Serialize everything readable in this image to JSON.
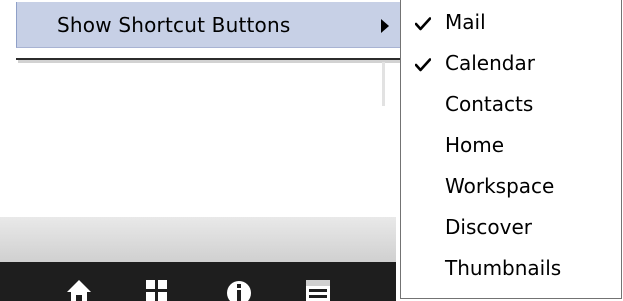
{
  "parent_menu": {
    "item_label": "Show Shortcut Buttons",
    "submenu_arrow_icon": "triangle-right-icon"
  },
  "submenu": {
    "items": [
      {
        "label": "Mail",
        "checked": true,
        "check_icon": "checkmark-icon"
      },
      {
        "label": "Calendar",
        "checked": true,
        "check_icon": "checkmark-icon"
      },
      {
        "label": "Contacts",
        "checked": false
      },
      {
        "label": "Home",
        "checked": false
      },
      {
        "label": "Workspace",
        "checked": false
      },
      {
        "label": "Discover",
        "checked": false
      },
      {
        "label": "Thumbnails",
        "checked": false
      }
    ]
  },
  "background_toolbar": {
    "icons": [
      "home-icon",
      "grid-icon",
      "info-icon",
      "calendar-icon"
    ]
  },
  "colors": {
    "highlight": "#c7d0e6",
    "toolbar_dark": "#1e1e1e",
    "submenu_border": "#737373"
  }
}
